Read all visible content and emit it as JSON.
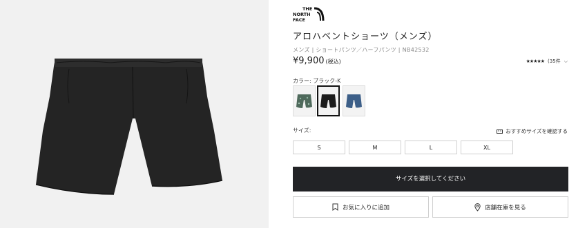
{
  "brand": {
    "line1": "THE",
    "line2": "NORTH",
    "line3": "FACE"
  },
  "product": {
    "title": "アロハベントショーツ（メンズ）",
    "meta": "メンズ | ショートパンツ／ハーフパンツ | NB42532",
    "price": "¥9,900",
    "tax": "(税込)",
    "rating_stars": "★★★★★",
    "rating_count": "(35件",
    "rating_chevron": "⌵",
    "rating_value": 4.5
  },
  "color": {
    "label": "カラー: ブラック-K",
    "swatches": [
      {
        "name": "pattern-green",
        "color": "#4f6a5c"
      },
      {
        "name": "black",
        "color": "#1c1c1c"
      },
      {
        "name": "denim-blue",
        "color": "#3d5f88"
      }
    ]
  },
  "size": {
    "label": "サイズ:",
    "guide_label": "おすすめサイズを確認する",
    "options": [
      "S",
      "M",
      "L",
      "XL"
    ]
  },
  "actions": {
    "select_size": "サイズを選択してください",
    "favorite": "お気に入りに追加",
    "store_stock": "店舗在庫を見る"
  }
}
